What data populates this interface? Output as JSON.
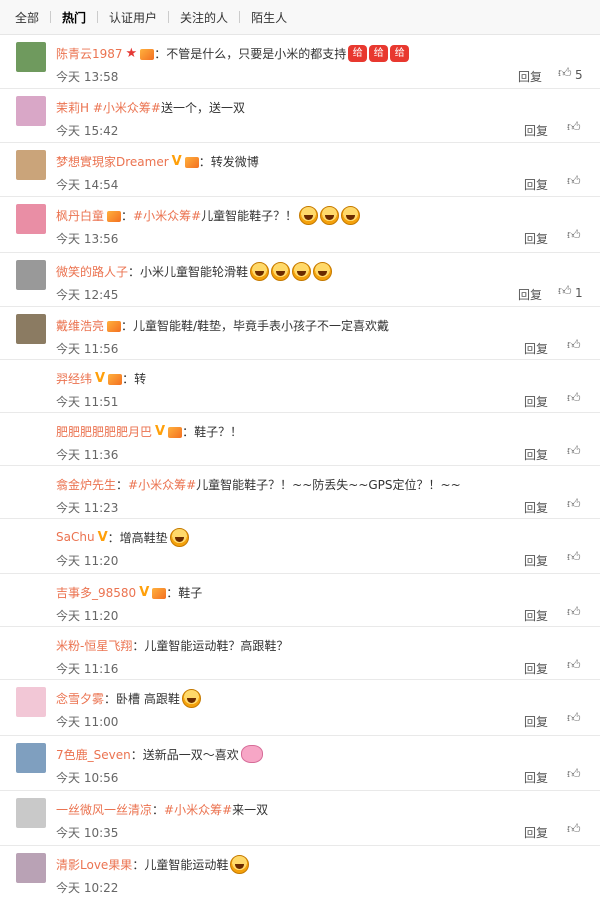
{
  "tabs": [
    "全部",
    "热门",
    "认证用户",
    "关注的人",
    "陌生人"
  ],
  "reply_label": "回复",
  "like_icon": "thumbs-up-icon",
  "comments": [
    {
      "user": "陈青云1987",
      "text": "：不管是什么，只要是小米的都支持",
      "time": "今天 13:58",
      "likes": "5",
      "emojis": [
        "给",
        "给",
        "给"
      ],
      "avatar": "#6f9a5e"
    },
    {
      "user": "茉莉H",
      "topic": "#小米众筹#",
      "text": " 送一个，送一双",
      "time": "今天 15:42",
      "avatar": "#d9a7c7"
    },
    {
      "user": "梦想實現家Dreamer",
      "text": "：转发微博",
      "time": "今天 14:54",
      "avatar": "#caa47a"
    },
    {
      "user": "枫丹白童",
      "topic": "#小米众筹#",
      "text": " 儿童智能鞋子？！",
      "time": "今天 13:56",
      "avatar": "#e98ea5"
    },
    {
      "user": "微笑的路人子",
      "text": "：小米儿童智能轮滑鞋",
      "time": "今天 12:45",
      "likes": "1",
      "avatar": "#999999"
    },
    {
      "user": "戴维浩亮",
      "text": "：儿童智能鞋/鞋垫，毕竟手表小孩子不一定喜欢戴",
      "time": "今天 11:56",
      "avatar": "#8b7b62"
    },
    {
      "user": "羿经纬",
      "text": "：转",
      "time": "今天 11:51"
    },
    {
      "user": "肥肥肥肥肥肥月巴",
      "text": "：鞋子？！",
      "time": "今天 11:36"
    },
    {
      "user": "翕金炉先生",
      "topic": "#小米众筹#",
      "text": " 儿童智能鞋子？！~~防丢失~~GPS定位？！~~",
      "time": "今天 11:23"
    },
    {
      "user": "SaChu",
      "text": "：增高鞋垫",
      "time": "今天 11:20"
    },
    {
      "user": "吉事多_98580",
      "text": "：鞋子",
      "time": "今天 11:20"
    },
    {
      "user": "米粉-恒星飞翔",
      "text": "：儿童智能运动鞋？高跟鞋？",
      "time": "今天 11:16"
    },
    {
      "user": "念雪夕雾",
      "text": "：卧槽 高跟鞋",
      "time": "今天 11:00",
      "avatar": "#f2c7d6"
    },
    {
      "user": "7色鹿_Seven",
      "text": "：送新品一双～喜欢",
      "time": "今天 10:56",
      "avatar": "#7f9fbf"
    },
    {
      "user": "一丝微风一丝清凉",
      "topic": "#小米众筹#",
      "text": "来一双",
      "time": "今天 10:35",
      "avatar": "#c9c9c9"
    },
    {
      "user": "清影Love果果",
      "text": "：儿童智能运动鞋",
      "time": "今天 10:22",
      "avatar": "#b9a2b5"
    }
  ]
}
